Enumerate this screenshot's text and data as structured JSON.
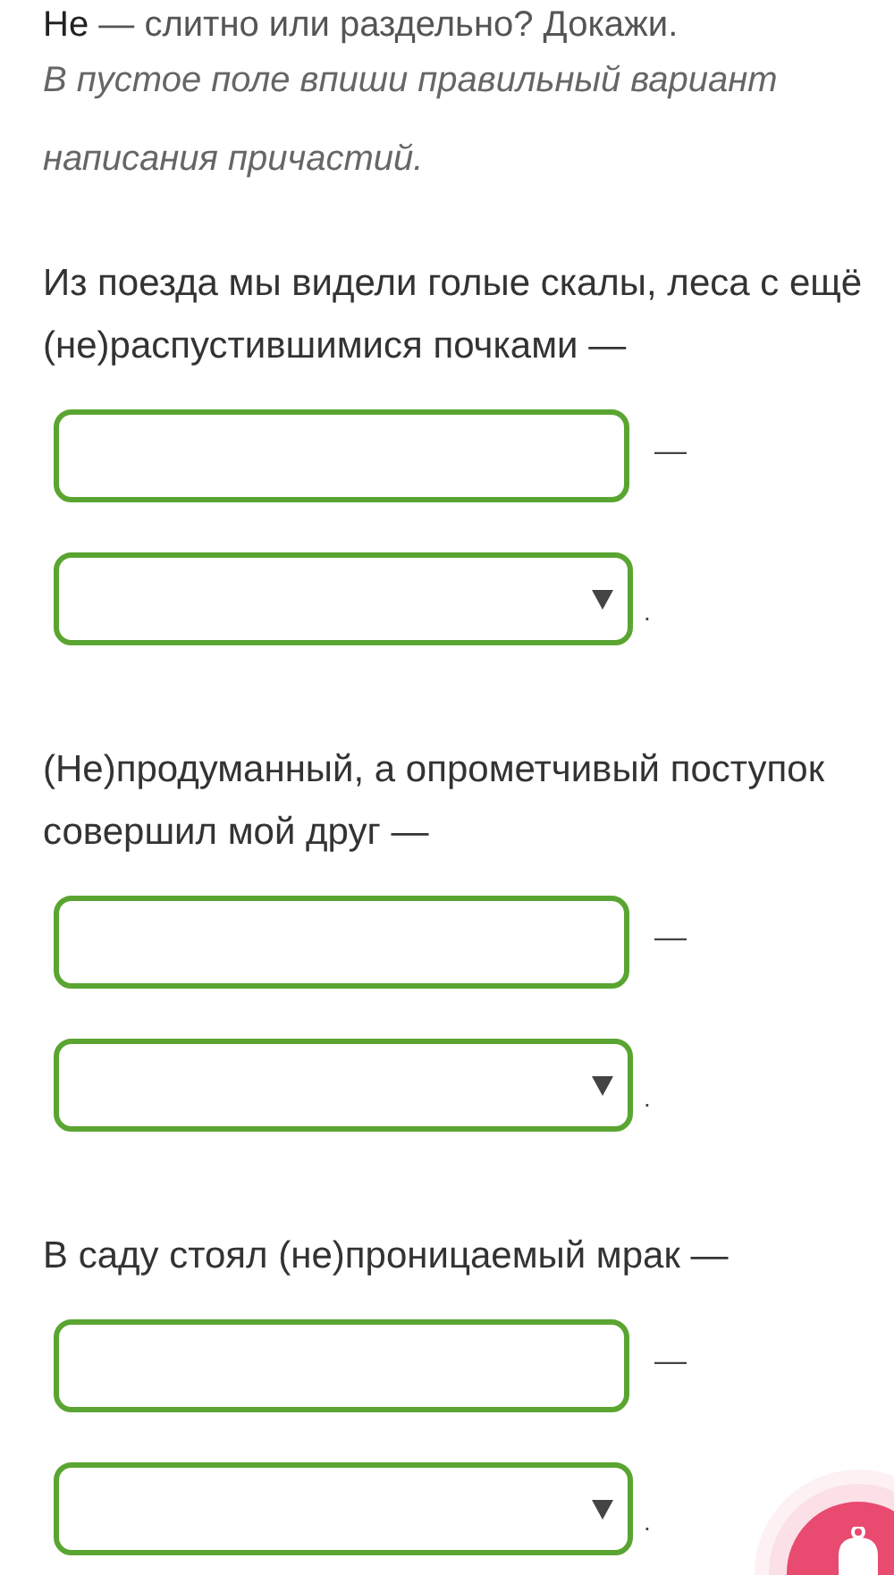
{
  "heading": "**Не** — слитно или раздельно? Докажи.",
  "instruction": "В пустое поле впиши правильный вариант написания причастий.",
  "tasks": [
    {
      "sentence": "Из поезда мы видели голые скалы, леса с ещё (не)распустившимися почками —",
      "after_input": "—",
      "after_select": "."
    },
    {
      "sentence": "(Не)продуманный, а опрометчивый поступок совершил мой друг —",
      "after_input": "—",
      "after_select": "."
    },
    {
      "sentence": "В саду стоял (не)проницаемый мрак —",
      "after_input": "—",
      "after_select": "."
    }
  ],
  "notification_button": {
    "kind": "bell"
  }
}
